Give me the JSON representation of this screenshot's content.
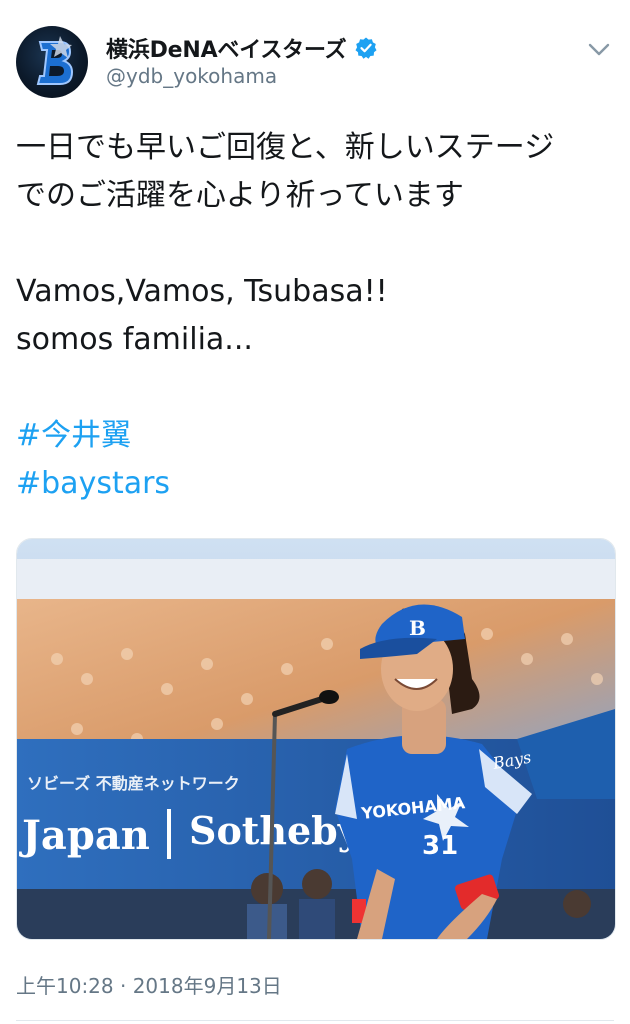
{
  "tweet": {
    "author": {
      "display_name": "横浜DeNAベイスターズ",
      "handle": "@ydb_yokohama",
      "verified": true,
      "avatar_icon": "baystars-b-logo-icon"
    },
    "menu_icon": "chevron-down-icon",
    "text_lines": [
      "一日でも早いご回復と、新しいステージ",
      "でのご活躍を心より祈っています",
      "",
      "Vamos,Vamos, Tsubasa!!",
      "somos familia...",
      ""
    ],
    "hashtags": [
      "#今井翼",
      "#baystars"
    ],
    "media": {
      "banner_text_1": "ソビーズ 不動産ネットワーク",
      "banner_text_2": "Japan",
      "banner_text_3": "Sotheby",
      "jersey_text": "YOKOHAMA",
      "jersey_number": "31",
      "sleeve_text": "Bays"
    },
    "timestamp": "上午10:28 · 2018年9月13日"
  },
  "colors": {
    "link": "#1da1f2",
    "secondary_text": "#657786",
    "jersey_blue": "#1f64c8"
  }
}
